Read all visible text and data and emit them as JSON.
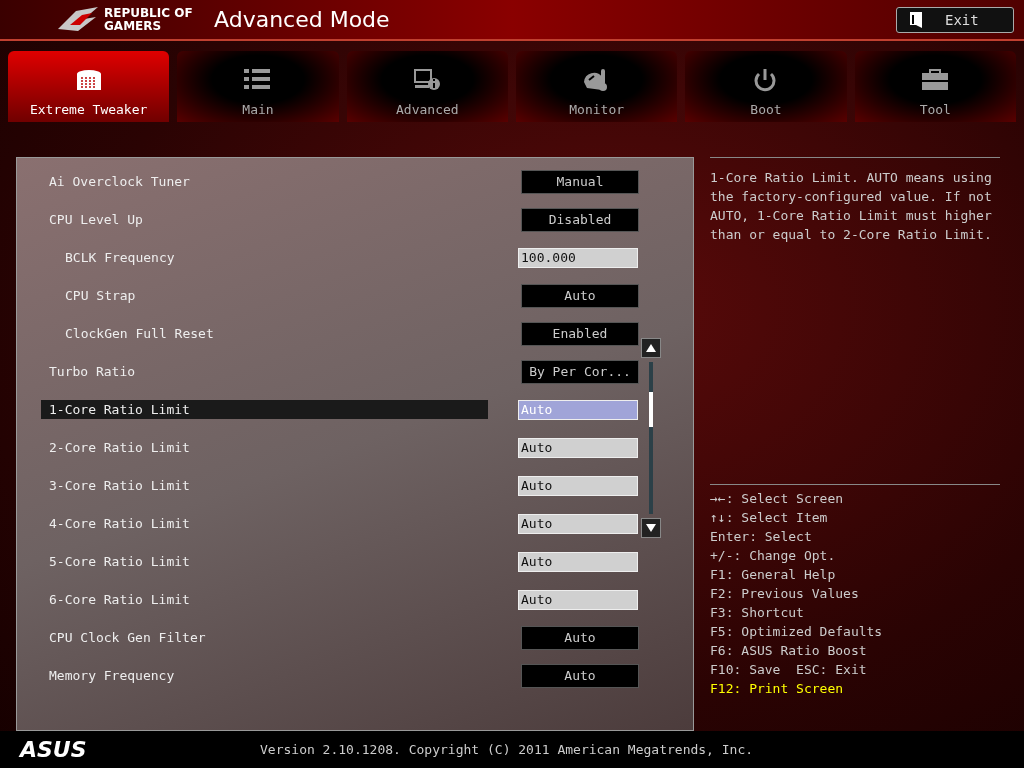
{
  "header": {
    "brand": [
      "REPUBLIC OF",
      "GAMERS"
    ],
    "title": "Advanced Mode",
    "exit_button": "Exit"
  },
  "tabs": [
    {
      "label": "Extreme Tweaker",
      "kind": "tweaker",
      "selected": true
    },
    {
      "label": "Main",
      "kind": "list",
      "selected": false
    },
    {
      "label": "Advanced",
      "kind": "info",
      "selected": false
    },
    {
      "label": "Monitor",
      "kind": "gauge",
      "selected": false
    },
    {
      "label": "Boot",
      "kind": "power",
      "selected": false
    },
    {
      "label": "Tool",
      "kind": "toolbox",
      "selected": false
    }
  ],
  "settings": [
    {
      "label": "Ai Overclock Tuner",
      "kind": "dropdown",
      "value": "Manual",
      "selected": false
    },
    {
      "label": "CPU Level Up",
      "kind": "dropdown",
      "value": "Disabled",
      "selected": false,
      "children": [
        {
          "label": "BCLK Frequency",
          "kind": "field",
          "value": "100.000",
          "selected": false
        },
        {
          "label": "CPU Strap",
          "kind": "dropdown",
          "value": "Auto",
          "selected": false
        },
        {
          "label": "ClockGen Full Reset",
          "kind": "dropdown",
          "value": "Enabled",
          "selected": false
        }
      ]
    },
    {
      "label": "Turbo Ratio",
      "kind": "dropdown",
      "value": "By Per Cor...",
      "selected": false
    },
    {
      "label": "1-Core Ratio Limit",
      "kind": "field",
      "value": "Auto",
      "selected": true
    },
    {
      "label": "2-Core Ratio Limit",
      "kind": "field",
      "value": "Auto",
      "selected": false
    },
    {
      "label": "3-Core Ratio Limit",
      "kind": "field",
      "value": "Auto",
      "selected": false
    },
    {
      "label": "4-Core Ratio Limit",
      "kind": "field",
      "value": "Auto",
      "selected": false
    },
    {
      "label": "5-Core Ratio Limit",
      "kind": "field",
      "value": "Auto",
      "selected": false
    },
    {
      "label": "6-Core Ratio Limit",
      "kind": "field",
      "value": "Auto",
      "selected": false
    },
    {
      "label": "CPU Clock Gen Filter",
      "kind": "dropdown",
      "value": "Auto",
      "selected": false
    },
    {
      "label": "Memory Frequency",
      "kind": "dropdown",
      "value": "Auto",
      "selected": false
    }
  ],
  "help_text": "1-Core Ratio Limit. AUTO means using the factory-configured value. If not AUTO, 1-Core Ratio Limit must higher than or equal to 2-Core Ratio Limit.",
  "key_legend": [
    {
      "text": "→←: Select Screen",
      "highlight": false
    },
    {
      "text": "↑↓: Select Item",
      "highlight": false
    },
    {
      "text": "Enter: Select",
      "highlight": false
    },
    {
      "text": "+/-: Change Opt.",
      "highlight": false
    },
    {
      "text": "F1: General Help",
      "highlight": false
    },
    {
      "text": "F2: Previous Values",
      "highlight": false
    },
    {
      "text": "F3: Shortcut",
      "highlight": false
    },
    {
      "text": "F5: Optimized Defaults",
      "highlight": false
    },
    {
      "text": "F6: ASUS Ratio Boost",
      "highlight": false
    },
    {
      "text": "F10: Save  ESC: Exit",
      "highlight": false
    },
    {
      "text": "F12: Print Screen",
      "highlight": true
    }
  ],
  "footer": {
    "logo": "ASUS",
    "version": "Version 2.10.1208. Copyright (C) 2011 American Megatrends, Inc."
  }
}
